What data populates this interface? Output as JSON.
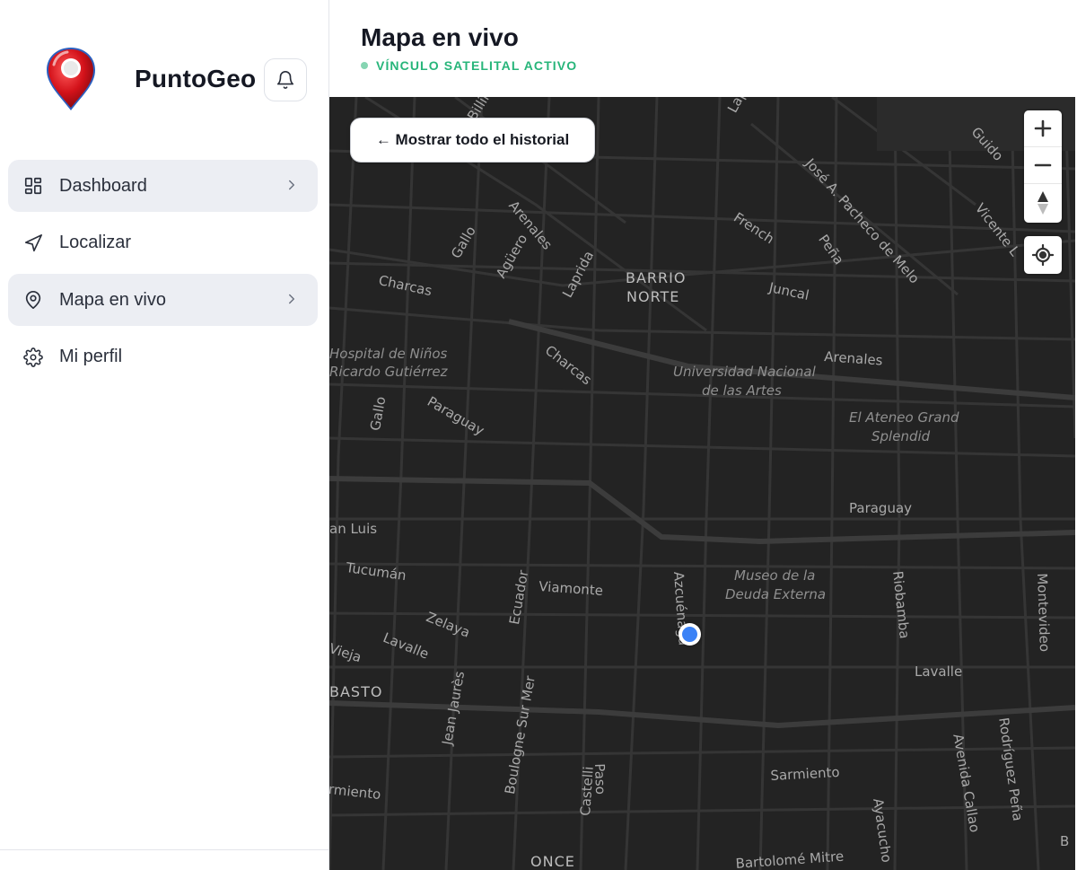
{
  "brand": {
    "name": "PuntoGeo"
  },
  "icons": {
    "logo": "map-pin-icon",
    "bell": "bell-icon"
  },
  "nav": {
    "items": [
      {
        "label": "Dashboard",
        "icon": "dashboard-grid-icon",
        "active": true,
        "has_chevron": true
      },
      {
        "label": "Localizar",
        "icon": "navigation-arrow-icon",
        "active": false,
        "has_chevron": false
      },
      {
        "label": "Mapa en vivo",
        "icon": "map-pin-outline-icon",
        "active": true,
        "has_chevron": true
      },
      {
        "label": "Mi perfil",
        "icon": "gear-icon",
        "active": false,
        "has_chevron": false
      }
    ]
  },
  "header": {
    "title": "Mapa en vivo",
    "status": "VÍNCULO SATELITAL ACTIVO",
    "status_color": "#27b57a"
  },
  "map": {
    "history_button": "← Mostrar todo el historial",
    "zoom_in": "+",
    "zoom_out": "−",
    "background_color": "#232323",
    "marker_color": "#3b82f6",
    "labels": {
      "billinghurst": "Billin",
      "laprida_top": "Lap",
      "guido": "Guido",
      "jose_pacheco": "José A. Pacheco de Melo",
      "vicente_lopez": "Vicente L",
      "arenales_top": "Arenales",
      "gallo_top": "Gallo",
      "aguero": "Agüero",
      "laprida": "Laprida",
      "french": "French",
      "pena": "Peña",
      "charcas_left": "Charcas",
      "barrio": "BARRIO",
      "norte": "NORTE",
      "juncal": "Juncal",
      "hospital_1": "Hospital de Niños",
      "hospital_2": "Ricardo Gutiérrez",
      "charcas_mid": "Charcas",
      "arenales_right": "Arenales",
      "universidad_1": "Universidad Nacional",
      "universidad_2": "de las Artes",
      "gallo_left": "Gallo",
      "paraguay_left": "Paraguay",
      "ateneo_1": "El Ateneo Grand",
      "ateneo_2": "Splendid",
      "paraguay_right": "Paraguay",
      "san_luis": "an Luis",
      "tucuman": "Tucumán",
      "ecuador": "Ecuador",
      "viamonte": "Viamonte",
      "azcuenaga": "Azcuénaga",
      "museo_1": "Museo de la",
      "museo_2": "Deuda Externa",
      "riobamba": "Riobamba",
      "montevideo": "Montevideo",
      "zelaya": "Zelaya",
      "lavalle_left": "Lavalle",
      "vieja": "Vieja",
      "lavalle_right": "Lavalle",
      "basto": "BASTO",
      "jean_jaures": "Jean Jaurès",
      "boulogne": "Boulogne Sur Mer",
      "rodriguez_pena": "Rodríguez Peña",
      "avenida_callao": "Avenida Callao",
      "sarmiento_right": "Sarmiento",
      "rmiento": "rmiento",
      "castelli": "Castelli",
      "paso": "Paso",
      "ayacucho": "Ayacucho",
      "once": "ONCE",
      "bartolome": "Bartolomé Mitre",
      "b_edge": "B"
    }
  }
}
